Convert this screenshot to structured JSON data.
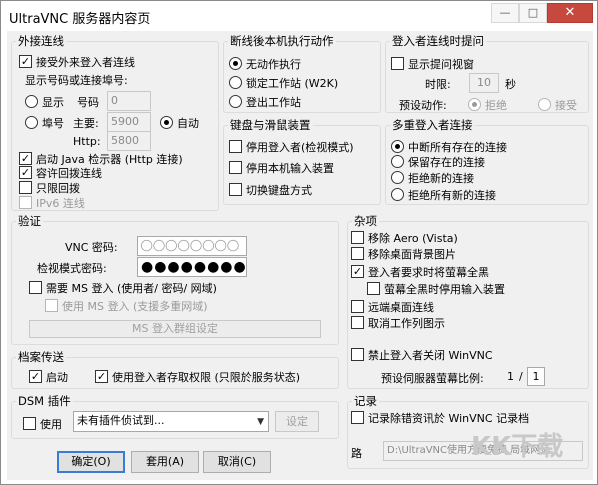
{
  "window": {
    "title": "UltraVNC 服务器内容页",
    "min_icon": "minimize-icon",
    "max_icon": "maximize-icon",
    "close_icon": "close-icon"
  },
  "incoming": {
    "legend": "外接连线",
    "accept_label": "接受外来登入者连线",
    "accept_checked": true,
    "display_label": "显示号码或连接埠号:",
    "radio_display": "显示",
    "radio_display_num": "号码",
    "radio_display_value": "0",
    "radio_port": "埠号",
    "main_label": "主要:",
    "main_value": "5900",
    "http_label": "Http:",
    "http_value": "5800",
    "auto_label": "自动",
    "java_label": "启动 Java 检示器 (Http 连接)",
    "java_checked": true,
    "loopback_label": "容许回拨连线",
    "loopback_checked": true,
    "loopback_only_label": "只限回拨",
    "loopback_only_checked": false,
    "ipv6_label": "IPv6 连线",
    "ipv6_checked": false
  },
  "disconnect": {
    "legend": "断线後本机执行动作",
    "opt1": "无动作执行",
    "opt2": "锁定工作站 (W2K)",
    "opt3": "登出工作站"
  },
  "timeout": {
    "legend": "登入者连线时提问",
    "show_label": "显示提问视窗",
    "show_checked": false,
    "time_label": "时限:",
    "time_value": "10",
    "time_unit": "秒",
    "default_label": "预设动作:",
    "refuse_label": "拒绝",
    "accept_label": "接受"
  },
  "keyboard": {
    "legend": "键盘与滑鼠装置",
    "disable_viewer": "停用登入者(检视模式)",
    "disable_local": "停用本机输入装置",
    "switch_layout": "切换键盘方式"
  },
  "multiuser": {
    "legend": "多重登入者连接",
    "opt1": "中断所有存在的连接",
    "opt2": "保留存在的连接",
    "opt3": "拒绝新的连接",
    "opt4": "拒绝所有新的连接"
  },
  "auth": {
    "legend": "验证",
    "vnc_pwd_label": "VNC 密码:",
    "vnc_pwd_value": "●●●●●●●●",
    "view_pwd_label": "检视模式密码:",
    "view_pwd_value": "●●●●●●●●",
    "ms_logon_label": "需要 MS 登入  (使用者/ 密码/ 网域)",
    "new_ms_logon_label": "使用 MS 登入 (支援多重网域)",
    "ms_groups_button": "MS 登入群组设定"
  },
  "misc": {
    "legend": "杂项",
    "remove_aero": "移除 Aero (Vista)",
    "remove_wallpaper": "移除桌面背景图片",
    "blank_screen": "登入者要求时将萤幕全黑",
    "blank_screen_checked": true,
    "disable_input_blank": "萤幕全黑时停用输入装置",
    "remote_desktop": "远端桌面连线",
    "capture_alpha": "取消工作列图示",
    "forbid_close": "禁止登入者关闭 WinVNC",
    "scale_label": "预设伺服器萤幕比例:",
    "scale_num": "1",
    "scale_sep": "/",
    "scale_den": "1"
  },
  "filetransfer": {
    "legend": "档案传送",
    "enable_label": "启动",
    "enable_checked": true,
    "user_impersonation": "使用登入者存取权限 (只限於服务状态)",
    "user_impersonation_checked": true
  },
  "dsm": {
    "legend": "DSM 插件",
    "use_label": "使用",
    "plugin_value": "未有插件侦试到...",
    "config_button": "设定"
  },
  "log": {
    "legend": "记录",
    "log_label": "记录除错资讯於 WinVNC 记录档",
    "path_label": "路",
    "path_value": "D:\\UltraVNC使用方便免费  局域网远"
  },
  "buttons": {
    "ok": "确定(O)",
    "apply": "套用(A)",
    "cancel": "取消(C)"
  },
  "watermark": {
    "text": "KK下载"
  }
}
